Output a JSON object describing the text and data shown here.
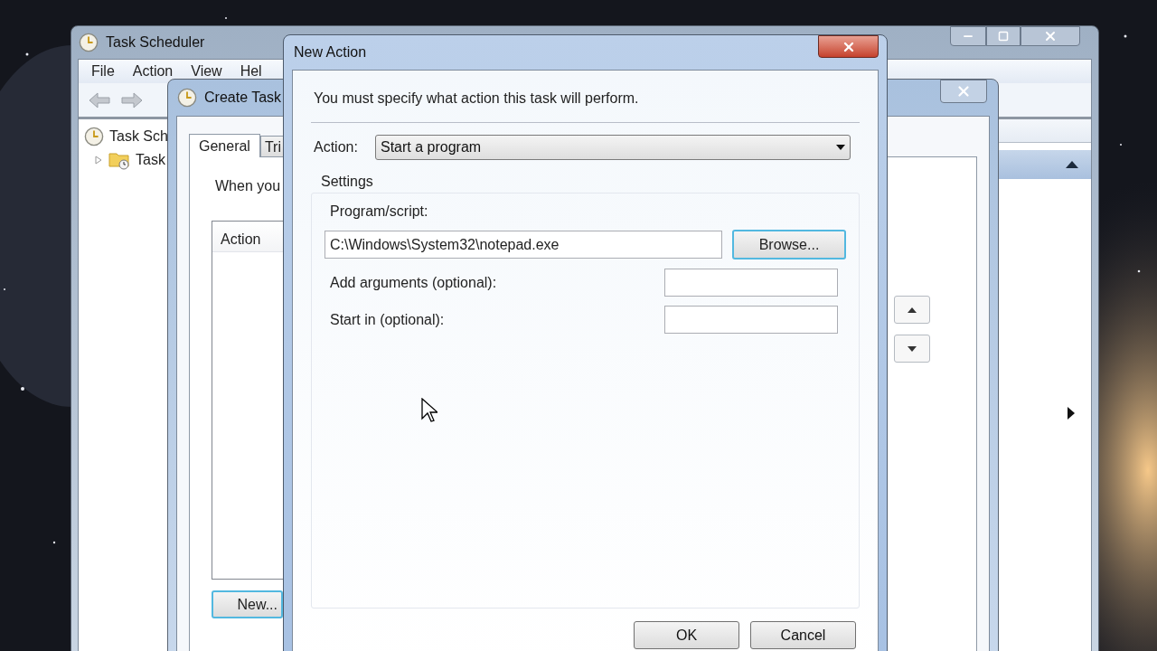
{
  "task_scheduler": {
    "title": "Task Scheduler",
    "menu": [
      "File",
      "Action",
      "View",
      "Hel"
    ],
    "tree": [
      {
        "label": "Task Sch",
        "children": [
          {
            "label": "Task",
            "expanded": false
          }
        ]
      }
    ]
  },
  "create_task": {
    "title": "Create Task",
    "tabs": [
      {
        "label": "General",
        "selected": true
      },
      {
        "label": "Tri",
        "selected": false
      }
    ],
    "description": "When you",
    "table": {
      "columns": [
        "Action"
      ]
    },
    "buttons": [
      "New..."
    ]
  },
  "new_action": {
    "title": "New Action",
    "instruction": "You must specify what action this task will perform.",
    "action": {
      "label": "Action:",
      "value": "Start a program"
    },
    "settings": {
      "title": "Settings",
      "fields": [
        {
          "kind": "stacked",
          "label": "Program/script:",
          "value": "C:\\Windows\\System32\\notepad.exe",
          "button": "Browse..."
        },
        {
          "kind": "inline",
          "label": "Add arguments (optional):"
        },
        {
          "kind": "inline",
          "label": "Start in (optional):"
        }
      ]
    },
    "buttons": [
      "OK",
      "Cancel"
    ]
  }
}
